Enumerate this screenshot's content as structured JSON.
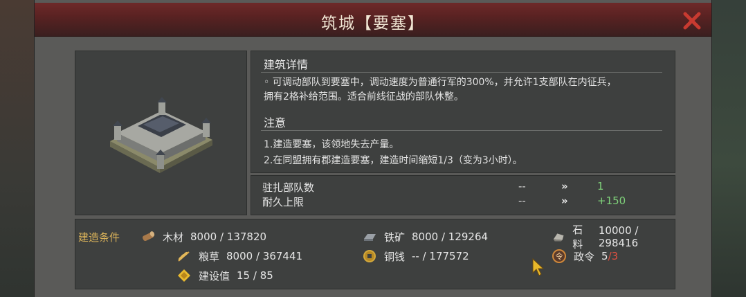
{
  "dialog": {
    "title": "筑城【要塞】"
  },
  "details": {
    "heading": "建筑详情",
    "description_line1": "◦ 可调动部队到要塞中，调动速度为普通行军的300%，并允许1支部队在内征兵，",
    "description_line2": "拥有2格补给范围。适合前线征战的部队休整。",
    "note_heading": "注意",
    "note1": "1.建造要塞，该领地失去产量。",
    "note2": "2.在同盟拥有郡建造要塞，建造时间缩短1/3（变为3小时）。"
  },
  "stats": [
    {
      "label": "驻扎部队数",
      "old": "--",
      "arrow": "»",
      "new": "1"
    },
    {
      "label": "耐久上限",
      "old": "--",
      "arrow": "»",
      "new": "+150"
    }
  ],
  "requirements": {
    "title": "建造条件",
    "wood": {
      "label": "木材",
      "value": "8000 / 137820",
      "icon": "wood-log-icon"
    },
    "iron": {
      "label": "铁矿",
      "value": "8000 / 129264",
      "icon": "iron-ingot-icon"
    },
    "stone": {
      "label": "石料",
      "value": "10000 / 298416",
      "icon": "stone-icon"
    },
    "grain": {
      "label": "粮草",
      "value": "8000 / 367441",
      "icon": "grain-icon"
    },
    "copper": {
      "label": "铜钱",
      "value": "-- / 177572",
      "icon": "coin-icon"
    },
    "order": {
      "label": "政令",
      "current": "5",
      "sep": " / ",
      "required": "3",
      "icon": "order-token-icon"
    },
    "build": {
      "label": "建设值",
      "value": "15 / 85",
      "icon": "construction-icon"
    }
  },
  "colors": {
    "accent_gold": "#d9b25a",
    "increase_green": "#7fd17a",
    "insufficient_red": "#e05040",
    "title_bar": "#6e2a2a"
  }
}
